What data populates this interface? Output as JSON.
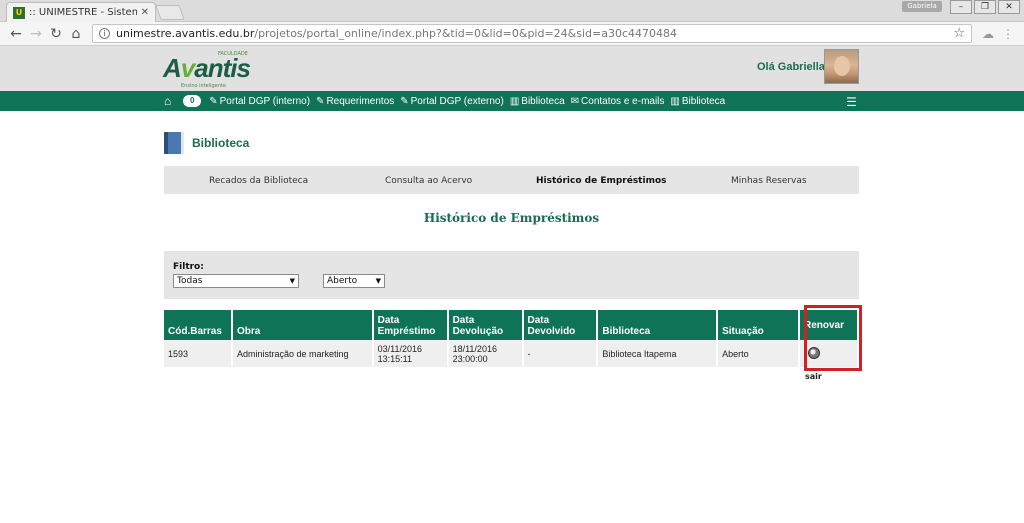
{
  "browser": {
    "tab_title": ":: UNIMESTRE - Sistema",
    "profile_name": "Gabriela",
    "url_domain": "unimestre.avantis.edu.br",
    "url_path": "/projetos/portal_online/index.php?&tid=0&lid=0&pid=24&sid=a30c4470484"
  },
  "header": {
    "logo_text_a": "A",
    "logo_text_v": "v",
    "logo_text_rest": "antis",
    "logo_top": "FACULDADE",
    "logo_tagline": "Ensino inteligente",
    "greeting": "Olá Gabriella"
  },
  "menu": {
    "badge": "0",
    "items": [
      {
        "label": "Portal DGP (interno)",
        "icon": "edit-icon"
      },
      {
        "label": "Requerimentos",
        "icon": "edit-icon"
      },
      {
        "label": "Portal DGP (externo)",
        "icon": "edit-icon"
      },
      {
        "label": "Biblioteca",
        "icon": "library-icon"
      },
      {
        "label": "Contatos e e-mails",
        "icon": "envelope-icon"
      },
      {
        "label": "Biblioteca",
        "icon": "library-icon"
      }
    ]
  },
  "section": {
    "title": "Biblioteca",
    "tabs": [
      "Recados da Biblioteca",
      "Consulta ao Acervo",
      "Histórico de Empréstimos",
      "Minhas Reservas"
    ],
    "active_tab": "Histórico de Empréstimos",
    "page_heading": "Histórico de Empréstimos"
  },
  "filter": {
    "label": "Filtro:",
    "select1_value": "Todas",
    "select2_value": "Aberto"
  },
  "table": {
    "headers": [
      "Cód.Barras",
      "Obra",
      "Data Empréstimo",
      "Data Devolução",
      "Data Devolvido",
      "Biblioteca",
      "Situação",
      "Renovar"
    ],
    "rows": [
      {
        "cod": "1593",
        "obra": "Administração de marketing",
        "emprestimo_date": "03/11/2016",
        "emprestimo_time": "13:15:11",
        "devolucao_date": "18/11/2016",
        "devolucao_time": "23:00:00",
        "devolvido": "-",
        "biblioteca": "Biblioteca Itapema",
        "situacao": "Aberto"
      }
    ]
  },
  "sair_label": "sair",
  "colors": {
    "brand_green": "#0f7357",
    "highlight_red": "#d42020"
  }
}
